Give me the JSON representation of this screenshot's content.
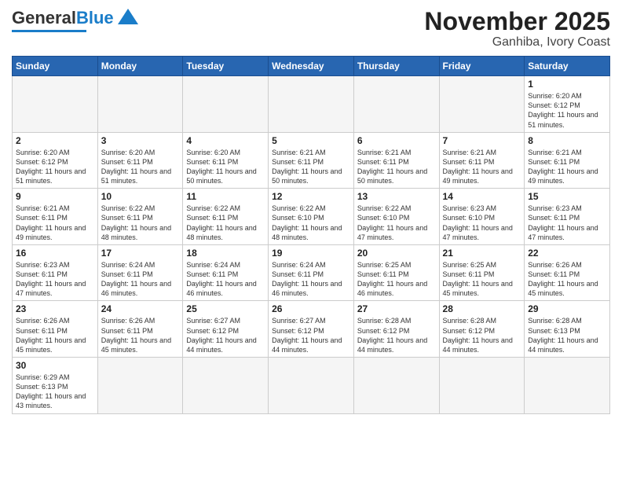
{
  "header": {
    "logo": {
      "part1": "General",
      "part2": "Blue"
    },
    "title": "November 2025",
    "subtitle": "Ganhiba, Ivory Coast"
  },
  "weekdays": [
    "Sunday",
    "Monday",
    "Tuesday",
    "Wednesday",
    "Thursday",
    "Friday",
    "Saturday"
  ],
  "days": [
    {
      "num": "",
      "info": ""
    },
    {
      "num": "",
      "info": ""
    },
    {
      "num": "",
      "info": ""
    },
    {
      "num": "",
      "info": ""
    },
    {
      "num": "",
      "info": ""
    },
    {
      "num": "",
      "info": ""
    },
    {
      "num": "1",
      "info": "Sunrise: 6:20 AM\nSunset: 6:12 PM\nDaylight: 11 hours\nand 51 minutes."
    },
    {
      "num": "2",
      "info": "Sunrise: 6:20 AM\nSunset: 6:12 PM\nDaylight: 11 hours\nand 51 minutes."
    },
    {
      "num": "3",
      "info": "Sunrise: 6:20 AM\nSunset: 6:11 PM\nDaylight: 11 hours\nand 51 minutes."
    },
    {
      "num": "4",
      "info": "Sunrise: 6:20 AM\nSunset: 6:11 PM\nDaylight: 11 hours\nand 50 minutes."
    },
    {
      "num": "5",
      "info": "Sunrise: 6:21 AM\nSunset: 6:11 PM\nDaylight: 11 hours\nand 50 minutes."
    },
    {
      "num": "6",
      "info": "Sunrise: 6:21 AM\nSunset: 6:11 PM\nDaylight: 11 hours\nand 50 minutes."
    },
    {
      "num": "7",
      "info": "Sunrise: 6:21 AM\nSunset: 6:11 PM\nDaylight: 11 hours\nand 49 minutes."
    },
    {
      "num": "8",
      "info": "Sunrise: 6:21 AM\nSunset: 6:11 PM\nDaylight: 11 hours\nand 49 minutes."
    },
    {
      "num": "9",
      "info": "Sunrise: 6:21 AM\nSunset: 6:11 PM\nDaylight: 11 hours\nand 49 minutes."
    },
    {
      "num": "10",
      "info": "Sunrise: 6:22 AM\nSunset: 6:11 PM\nDaylight: 11 hours\nand 48 minutes."
    },
    {
      "num": "11",
      "info": "Sunrise: 6:22 AM\nSunset: 6:11 PM\nDaylight: 11 hours\nand 48 minutes."
    },
    {
      "num": "12",
      "info": "Sunrise: 6:22 AM\nSunset: 6:10 PM\nDaylight: 11 hours\nand 48 minutes."
    },
    {
      "num": "13",
      "info": "Sunrise: 6:22 AM\nSunset: 6:10 PM\nDaylight: 11 hours\nand 47 minutes."
    },
    {
      "num": "14",
      "info": "Sunrise: 6:23 AM\nSunset: 6:10 PM\nDaylight: 11 hours\nand 47 minutes."
    },
    {
      "num": "15",
      "info": "Sunrise: 6:23 AM\nSunset: 6:11 PM\nDaylight: 11 hours\nand 47 minutes."
    },
    {
      "num": "16",
      "info": "Sunrise: 6:23 AM\nSunset: 6:11 PM\nDaylight: 11 hours\nand 47 minutes."
    },
    {
      "num": "17",
      "info": "Sunrise: 6:24 AM\nSunset: 6:11 PM\nDaylight: 11 hours\nand 46 minutes."
    },
    {
      "num": "18",
      "info": "Sunrise: 6:24 AM\nSunset: 6:11 PM\nDaylight: 11 hours\nand 46 minutes."
    },
    {
      "num": "19",
      "info": "Sunrise: 6:24 AM\nSunset: 6:11 PM\nDaylight: 11 hours\nand 46 minutes."
    },
    {
      "num": "20",
      "info": "Sunrise: 6:25 AM\nSunset: 6:11 PM\nDaylight: 11 hours\nand 46 minutes."
    },
    {
      "num": "21",
      "info": "Sunrise: 6:25 AM\nSunset: 6:11 PM\nDaylight: 11 hours\nand 45 minutes."
    },
    {
      "num": "22",
      "info": "Sunrise: 6:26 AM\nSunset: 6:11 PM\nDaylight: 11 hours\nand 45 minutes."
    },
    {
      "num": "23",
      "info": "Sunrise: 6:26 AM\nSunset: 6:11 PM\nDaylight: 11 hours\nand 45 minutes."
    },
    {
      "num": "24",
      "info": "Sunrise: 6:26 AM\nSunset: 6:11 PM\nDaylight: 11 hours\nand 45 minutes."
    },
    {
      "num": "25",
      "info": "Sunrise: 6:27 AM\nSunset: 6:12 PM\nDaylight: 11 hours\nand 44 minutes."
    },
    {
      "num": "26",
      "info": "Sunrise: 6:27 AM\nSunset: 6:12 PM\nDaylight: 11 hours\nand 44 minutes."
    },
    {
      "num": "27",
      "info": "Sunrise: 6:28 AM\nSunset: 6:12 PM\nDaylight: 11 hours\nand 44 minutes."
    },
    {
      "num": "28",
      "info": "Sunrise: 6:28 AM\nSunset: 6:12 PM\nDaylight: 11 hours\nand 44 minutes."
    },
    {
      "num": "29",
      "info": "Sunrise: 6:28 AM\nSunset: 6:13 PM\nDaylight: 11 hours\nand 44 minutes."
    },
    {
      "num": "30",
      "info": "Sunrise: 6:29 AM\nSunset: 6:13 PM\nDaylight: 11 hours\nand 43 minutes."
    },
    {
      "num": "",
      "info": ""
    },
    {
      "num": "",
      "info": ""
    },
    {
      "num": "",
      "info": ""
    },
    {
      "num": "",
      "info": ""
    },
    {
      "num": "",
      "info": ""
    },
    {
      "num": "",
      "info": ""
    }
  ]
}
